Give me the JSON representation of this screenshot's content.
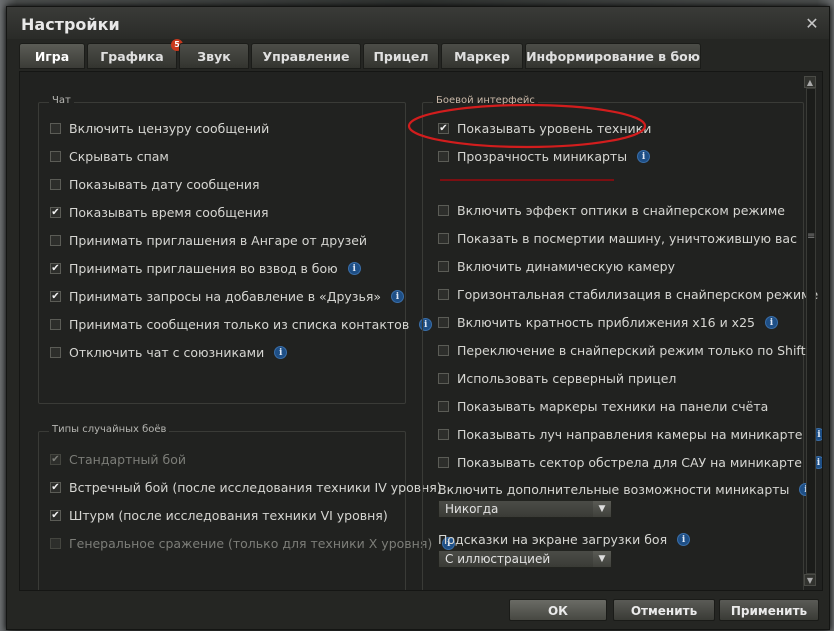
{
  "window": {
    "title": "Настройки",
    "close": "✕"
  },
  "tabs": [
    {
      "label": "Игра",
      "active": true
    },
    {
      "label": "Графика",
      "badge": "5"
    },
    {
      "label": "Звук"
    },
    {
      "label": "Управление"
    },
    {
      "label": "Прицел"
    },
    {
      "label": "Маркер"
    },
    {
      "label": "Информирование в бою"
    }
  ],
  "chat": {
    "title": "Чат",
    "options": [
      {
        "label": "Включить цензуру сообщений",
        "checked": false
      },
      {
        "label": "Скрывать спам",
        "checked": false
      },
      {
        "label": "Показывать дату сообщения",
        "checked": false
      },
      {
        "label": "Показывать время сообщения",
        "checked": true
      },
      {
        "label": "Принимать приглашения в Ангаре от друзей",
        "checked": false
      },
      {
        "label": "Принимать приглашения во взвод в бою",
        "checked": true,
        "info": true
      },
      {
        "label": "Принимать запросы на добавление в «Друзья»",
        "checked": true,
        "info": true
      },
      {
        "label": "Принимать сообщения только из списка контактов",
        "checked": false,
        "info": true
      },
      {
        "label": "Отключить чат с союзниками",
        "checked": false,
        "info": true
      }
    ]
  },
  "battles": {
    "title": "Типы случайных боёв",
    "options": [
      {
        "label": "Стандартный бой",
        "checked": true,
        "disabled": true
      },
      {
        "label": "Встречный бой (после исследования техники IV уровня)",
        "checked": true
      },
      {
        "label": "Штурм (после исследования техники VI уровня)",
        "checked": true
      },
      {
        "label": "Генеральное сражение (только для техники X уровня)",
        "checked": false,
        "disabled": true,
        "info": true
      }
    ]
  },
  "battle_interface": {
    "title": "Боевой интерфейс",
    "options": [
      {
        "label": "Показывать уровень техники",
        "checked": true
      },
      {
        "label": "Прозрачность миникарты",
        "checked": false,
        "info": true
      },
      {
        "label": "Включить эффект оптики в снайперском режиме",
        "checked": false
      },
      {
        "label": "Показать в посмертии машину, уничтожившую вас",
        "checked": false
      },
      {
        "label": "Включить динамическую камеру",
        "checked": false
      },
      {
        "label": "Горизонтальная стабилизация в снайперском режиме",
        "checked": false
      },
      {
        "label": "Включить кратность приближения x16 и x25",
        "checked": false,
        "info": true
      },
      {
        "label": "Переключение в снайперский режим только по Shift",
        "checked": false
      },
      {
        "label": "Использовать серверный прицел",
        "checked": false
      },
      {
        "label": "Показывать маркеры техники на панели счёта",
        "checked": false
      },
      {
        "label": "Показывать луч направления камеры на миникарте",
        "checked": false,
        "info": true
      },
      {
        "label": "Показывать сектор обстрела для САУ на миникарте",
        "checked": false,
        "info": true
      }
    ],
    "minimap_extra": {
      "label": "Включить дополнительные возможности миникарты",
      "value": "Никогда"
    },
    "loading_hints": {
      "label": "Подсказки на экране загрузки боя",
      "value": "С иллюстрацией"
    }
  },
  "buttons": {
    "ok": "ОК",
    "cancel": "Отменить",
    "apply": "Применить"
  },
  "colors": {
    "annotation": "#d21d1d",
    "info": "#1e4f86"
  }
}
